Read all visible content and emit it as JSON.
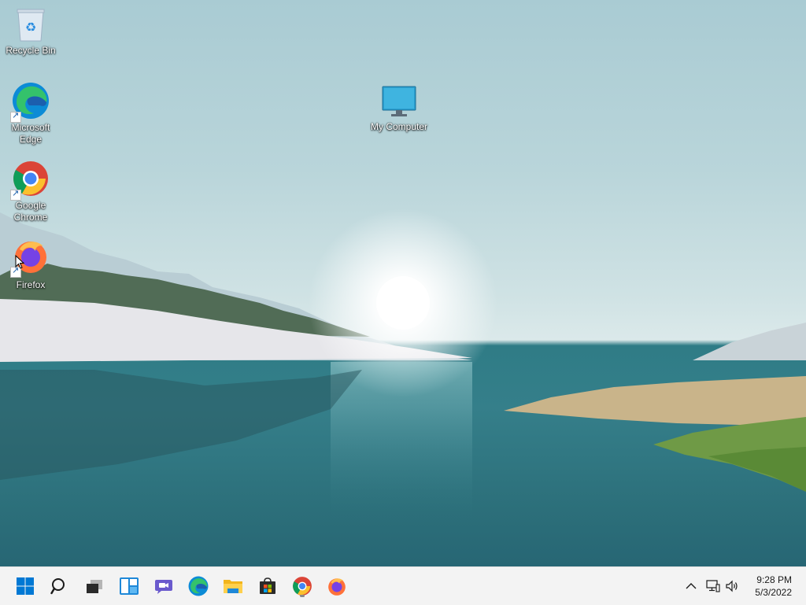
{
  "desktop": {
    "icons": [
      {
        "label": "Recycle Bin",
        "icon": "recycle-bin-icon"
      },
      {
        "label": "Microsoft Edge",
        "icon": "edge-icon"
      },
      {
        "label": "Google Chrome",
        "icon": "chrome-icon"
      },
      {
        "label": "Firefox",
        "icon": "firefox-icon"
      },
      {
        "label": "My Computer",
        "icon": "monitor-icon"
      }
    ]
  },
  "taskbar": {
    "items": [
      {
        "name": "Start",
        "icon": "windows-start-icon"
      },
      {
        "name": "Search",
        "icon": "search-icon"
      },
      {
        "name": "Task View",
        "icon": "task-view-icon"
      },
      {
        "name": "Widgets",
        "icon": "widgets-icon"
      },
      {
        "name": "Chat",
        "icon": "teams-chat-icon"
      },
      {
        "name": "Microsoft Edge",
        "icon": "edge-icon"
      },
      {
        "name": "File Explorer",
        "icon": "folder-icon"
      },
      {
        "name": "Microsoft Store",
        "icon": "store-icon"
      },
      {
        "name": "Google Chrome",
        "icon": "chrome-icon",
        "running": true
      },
      {
        "name": "Firefox",
        "icon": "firefox-icon"
      }
    ],
    "tray": {
      "chevron_icon": "chevron-up-icon",
      "network_icon": "network-icon",
      "volume_icon": "volume-icon"
    },
    "clock": {
      "time": "9:28 PM",
      "date": "5/3/2022"
    }
  },
  "colors": {
    "taskbar_bg": "#f3f3f3",
    "accent_blue": "#0078d4"
  }
}
